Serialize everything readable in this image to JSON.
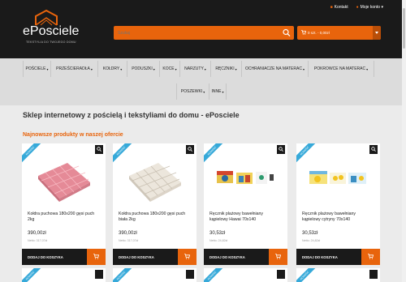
{
  "header": {
    "logo_text": "ePosciele",
    "logo_tagline": "TEKSTYLIA DO TWOJEGO DOMU",
    "top_links": [
      {
        "label": "Kontakt",
        "icon": "phone-icon"
      },
      {
        "label": "Moje konto",
        "icon": "user-icon"
      }
    ],
    "search": {
      "placeholder": "Szukaj"
    },
    "cart": {
      "label": "0 szt. - 0,00zł"
    }
  },
  "nav": {
    "items": [
      {
        "label": "POŚCIELE",
        "caret": true
      },
      {
        "label": "PRZEŚCIERADŁA",
        "caret": true
      },
      {
        "label": "KOŁDRY",
        "caret": true
      },
      {
        "label": "PODUSZKI",
        "caret": true
      },
      {
        "label": "KOCE",
        "caret": true
      },
      {
        "label": "NARZUTY",
        "caret": true
      },
      {
        "label": "RĘCZNIKI",
        "caret": true
      },
      {
        "label": "OCHRANIACZE NA MATERAC",
        "caret": true
      },
      {
        "label": "POKROWCE NA MATERAC",
        "caret": true
      },
      {
        "label": "POSZEWKI",
        "caret": true
      },
      {
        "label": "INNE",
        "caret": true
      }
    ]
  },
  "main": {
    "heading": "Sklep internetowy z pościelą i tekstyliami do domu - ePosciele",
    "section_title": "Najnowsze produkty w naszej ofercie",
    "ribbon_label": "NOWOŚĆ",
    "add_to_cart_label": "DODAJ DO KOSZYKA",
    "products": [
      {
        "name": "Kołdra puchowa 180x200 gęsi puch 2kg",
        "price": "390,00zł",
        "net": "Netto: 317,07zł",
        "image": "pink-duvet"
      },
      {
        "name": "Kołdra puchowa 180x200 gęsi puch biała 2kg",
        "price": "390,00zł",
        "net": "Netto: 317,07zł",
        "image": "white-duvet"
      },
      {
        "name": "Ręcznik plażowy bawełniany kąpielowy Hawai 70x140",
        "price": "30,53zł",
        "net": "Netto: 24,82zł",
        "image": "hawai-towel"
      },
      {
        "name": "Ręcznik plażowy bawełniany kąpielowy cytryny 70x140",
        "price": "30,53zł",
        "net": "Netto: 24,82zł",
        "image": "lemon-towel"
      }
    ]
  },
  "colors": {
    "accent": "#e8640c",
    "header_bg": "#1a1a1a",
    "ribbon": "#36a9d9"
  }
}
